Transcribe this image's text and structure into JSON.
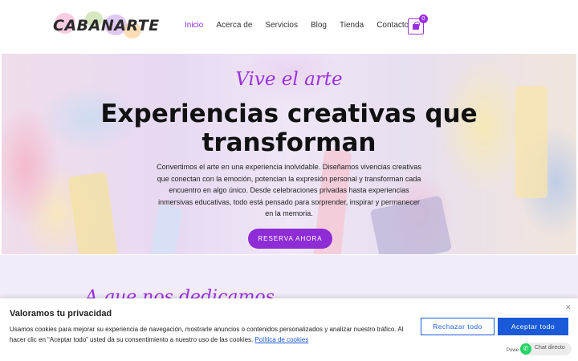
{
  "header": {
    "logo_text": "CABANARTE",
    "nav": [
      {
        "label": "Inicio",
        "active": true
      },
      {
        "label": "Acerca de",
        "active": false
      },
      {
        "label": "Servicios",
        "active": false
      },
      {
        "label": "Blog",
        "active": false
      },
      {
        "label": "Tienda",
        "active": false
      },
      {
        "label": "Contacto",
        "active": false
      }
    ],
    "cart_count": "0",
    "accent_color": "#9b30e0"
  },
  "hero": {
    "script_title": "Vive el arte",
    "title_line1": "Experiencias creativas que",
    "title_line2": "transforman",
    "description": "Convertimos el arte en una experiencia inolvidable. Diseñamos vivencias creativas que conectan con la emoción, potencian la expresión personal y transforman cada encuentro en algo único. Desde celebraciones privadas hasta experiencias inmersivas educativas, todo está pensado para sorprender, inspirar y permanecer en la memoria.",
    "cta_label": "RESERVA AHORA"
  },
  "section": {
    "script_heading": "A que nos dedicamos"
  },
  "cookie": {
    "title": "Valoramos tu privacidad",
    "text": "Usamos cookies para mejorar su experiencia de navegación, mostrarle anuncios o contenidos personalizados y analizar nuestro tráfico. Al hacer clic en “Aceptar todo” usted da su consentimiento a nuestro uso de las cookies.",
    "policy_link": "Política de cookies",
    "reject_label": "Rechazar todo",
    "accept_label": "Aceptar todo",
    "close_icon": "close-icon",
    "primary_color": "#1a5ad9"
  },
  "chat": {
    "powered_text": "Powe",
    "label": "Chat directo",
    "icon": "whatsapp-icon"
  }
}
